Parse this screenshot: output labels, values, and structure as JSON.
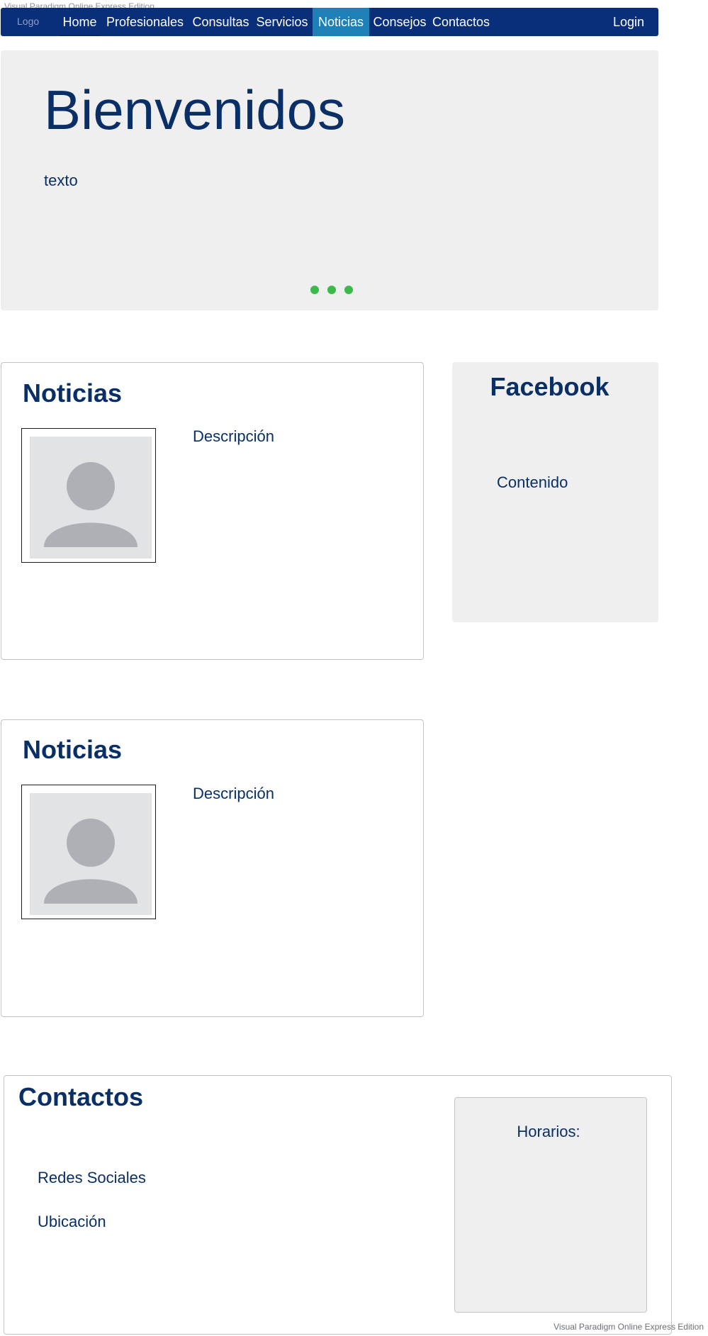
{
  "watermark": "Visual Paradigm Online Express Edition",
  "nav": {
    "logo": "Logo",
    "items": [
      {
        "label": "Home"
      },
      {
        "label": "Profesionales"
      },
      {
        "label": "Consultas"
      },
      {
        "label": "Servicios"
      },
      {
        "label": "Noticias",
        "active": true
      },
      {
        "label": "Consejos"
      },
      {
        "label": "Contactos"
      }
    ],
    "login": "Login"
  },
  "hero": {
    "title": "Bienvenidos",
    "text": "texto",
    "carousel_dots": 3,
    "dot_color": "#3db84a"
  },
  "news": [
    {
      "title": "Noticias",
      "description": "Descripción",
      "image_icon": "person-placeholder-icon"
    },
    {
      "title": "Noticias",
      "description": "Descripción",
      "image_icon": "person-placeholder-icon"
    }
  ],
  "facebook": {
    "title": "Facebook",
    "content": "Contenido"
  },
  "contacts": {
    "title": "Contactos",
    "social": "Redes Sociales",
    "location": "Ubicación",
    "hours_label": "Horarios:"
  },
  "colors": {
    "nav_bg": "#0a2f7a",
    "nav_active": "#1d81b8",
    "text_primary": "#0a2f66",
    "panel_bg": "#efefef"
  }
}
